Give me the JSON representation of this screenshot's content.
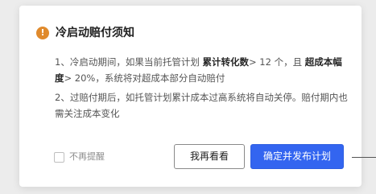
{
  "dialog": {
    "title": "冷启动赔付须知",
    "warning_icon": "exclamation-circle-icon",
    "warning_glyph": "!",
    "paragraph1": {
      "prefix": "1、冷启动期间，如果当前托管计划 ",
      "bold1": "累计转化数",
      "mid": "> 12 个，且 ",
      "bold2": "超成本幅度",
      "suffix": "> 20%，系统将对超成本部分自动赔付"
    },
    "paragraph2": "2、过赔付期后，如托管计划累计成本过高系统将自动关停。赔付期内也需关注成本变化",
    "checkbox_label": "不再提醒",
    "secondary_button": "我再看看",
    "primary_button": "确定并发布计划"
  },
  "colors": {
    "primary": "#3365f0",
    "warning": "#e08a2c"
  }
}
